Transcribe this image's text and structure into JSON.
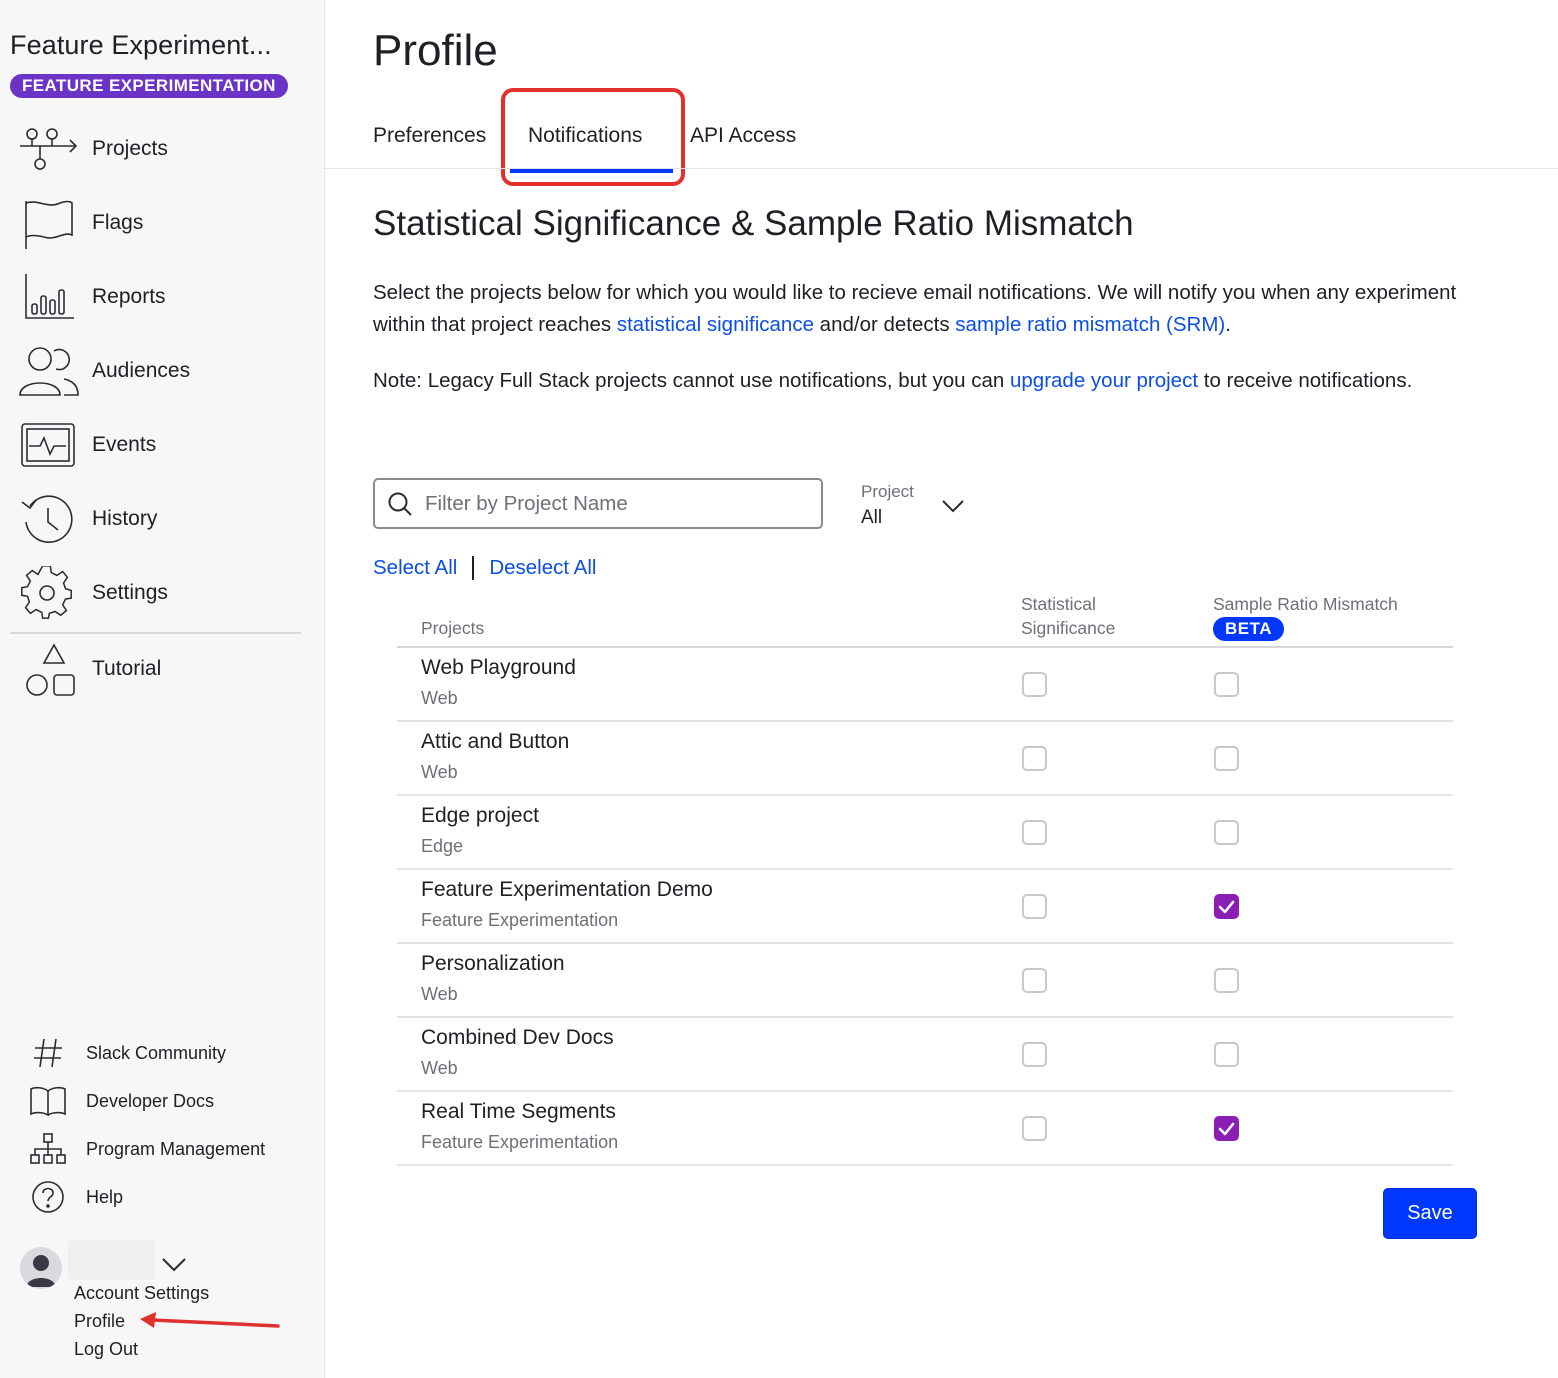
{
  "app": {
    "title": "Feature Experiment...",
    "badge": "FEATURE EXPERIMENTATION",
    "badge_color": "#6b34c6"
  },
  "sidebar": {
    "nav": [
      {
        "label": "Projects",
        "icon": "projects-icon"
      },
      {
        "label": "Flags",
        "icon": "flag-icon"
      },
      {
        "label": "Reports",
        "icon": "reports-icon"
      },
      {
        "label": "Audiences",
        "icon": "audiences-icon"
      },
      {
        "label": "Events",
        "icon": "events-icon"
      },
      {
        "label": "History",
        "icon": "history-icon"
      },
      {
        "label": "Settings",
        "icon": "gear-icon"
      },
      {
        "label": "Tutorial",
        "icon": "shapes-icon"
      }
    ],
    "utilities": [
      {
        "label": "Slack Community",
        "icon": "hash-icon"
      },
      {
        "label": "Developer Docs",
        "icon": "book-icon"
      },
      {
        "label": "Program Management",
        "icon": "org-chart-icon"
      },
      {
        "label": "Help",
        "icon": "help-icon"
      }
    ],
    "user_menu": {
      "account_settings": "Account Settings",
      "profile": "Profile",
      "log_out": "Log Out"
    }
  },
  "page": {
    "title": "Profile",
    "tabs": [
      {
        "label": "Preferences",
        "active": false
      },
      {
        "label": "Notifications",
        "active": true
      },
      {
        "label": "API Access",
        "active": false
      }
    ],
    "section_title": "Statistical Significance & Sample Ratio Mismatch",
    "intro": {
      "text1": "Select the projects below for which you would like to recieve email notifications. We will notify you when any experiment within that project reaches ",
      "link1": "statistical significance",
      "text2": " and/or detects ",
      "link2": "sample ratio mismatch (SRM)",
      "text3": "."
    },
    "note": {
      "text1": "Note: Legacy Full Stack projects cannot use notifications, but you can ",
      "link": "upgrade your project",
      "text2": " to receive notifications."
    },
    "search": {
      "placeholder": "Filter by Project Name",
      "value": ""
    },
    "project_filter": {
      "label": "Project",
      "value": "All"
    },
    "select_all": "Select All",
    "deselect_all": "Deselect All",
    "table": {
      "col_projects": "Projects",
      "col_ss_line1": "Statistical",
      "col_ss_line2": "Significance",
      "col_srm": "Sample Ratio Mismatch",
      "col_srm_badge": "BETA",
      "rows": [
        {
          "name": "Web Playground",
          "type": "Web",
          "ss": false,
          "srm": false
        },
        {
          "name": "Attic and Button",
          "type": "Web",
          "ss": false,
          "srm": false
        },
        {
          "name": "Edge project",
          "type": "Edge",
          "ss": false,
          "srm": false
        },
        {
          "name": "Feature Experimentation Demo",
          "type": "Feature Experimentation",
          "ss": false,
          "srm": true
        },
        {
          "name": "Personalization",
          "type": "Web",
          "ss": false,
          "srm": false
        },
        {
          "name": "Combined Dev Docs",
          "type": "Web",
          "ss": false,
          "srm": false
        },
        {
          "name": "Real Time Segments",
          "type": "Feature Experimentation",
          "ss": false,
          "srm": true
        }
      ]
    },
    "save_label": "Save"
  },
  "colors": {
    "accent_blue": "#0037ff",
    "link_blue": "#0b4ee6",
    "checkbox_checked": "#8a1eb5",
    "annotation_red": "#e0312f"
  }
}
